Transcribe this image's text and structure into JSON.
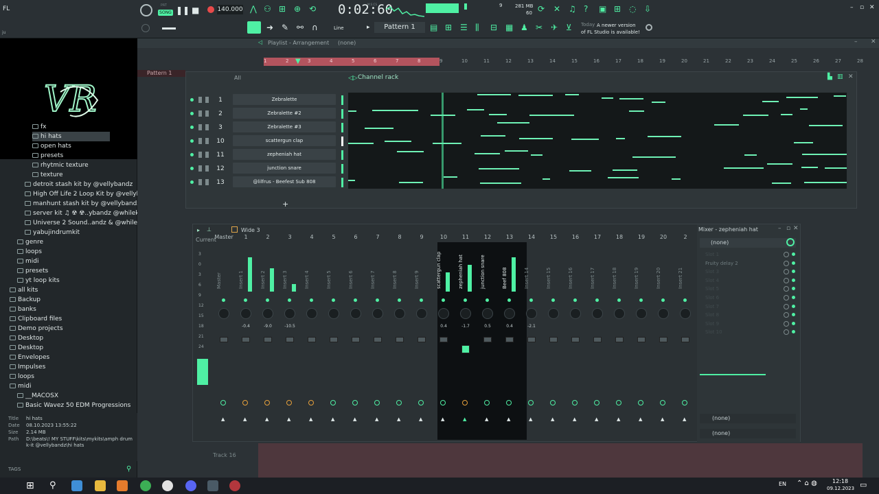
{
  "toolbar": {
    "menu": "FL",
    "song_mode": "SONG",
    "pat_label": "PAT",
    "tempo": "140.000",
    "time": "0:02:60",
    "time_unit": "M:S:CS",
    "memory": "281 MB",
    "cpu_line": "60",
    "poly": "9",
    "pattern": "Pattern 1",
    "snap": "Line",
    "news_today": "Today",
    "news_text": "A newer version of FL Studio is available!"
  },
  "browser": {
    "logo_text": "VR",
    "items": [
      {
        "label": "fx",
        "indent": 3
      },
      {
        "label": "hi hats",
        "indent": 3,
        "selected": true
      },
      {
        "label": "open hats",
        "indent": 3
      },
      {
        "label": "presets",
        "indent": 3
      },
      {
        "label": "rhytmic texture",
        "indent": 3
      },
      {
        "label": "texture",
        "indent": 3
      },
      {
        "label": "detroit stash kit by @vellybandz",
        "indent": 2
      },
      {
        "label": "High Off Life 2 Loop Kit by @vellybandz",
        "indent": 2
      },
      {
        "label": "manhunt stash kit by @vellybandz",
        "indent": 2
      },
      {
        "label": "server kit ♫ ☢ ☢..ybandz @whilekeed",
        "indent": 2
      },
      {
        "label": "Universe 2 Sound..andz & @whilekeed47",
        "indent": 2
      },
      {
        "label": "yabujindrumkit",
        "indent": 2
      },
      {
        "label": "genre",
        "indent": 1
      },
      {
        "label": "loops",
        "indent": 1
      },
      {
        "label": "midi",
        "indent": 1
      },
      {
        "label": "presets",
        "indent": 1
      },
      {
        "label": "yt loop kits",
        "indent": 1
      },
      {
        "label": "all kits",
        "indent": 0
      },
      {
        "label": "Backup",
        "indent": 0
      },
      {
        "label": "banks",
        "indent": 0
      },
      {
        "label": "Clipboard files",
        "indent": 0
      },
      {
        "label": "Demo projects",
        "indent": 0
      },
      {
        "label": "Desktop",
        "indent": 0
      },
      {
        "label": "Desktop",
        "indent": 0
      },
      {
        "label": "Envelopes",
        "indent": 0
      },
      {
        "label": "Impulses",
        "indent": 0
      },
      {
        "label": "loops",
        "indent": 0
      },
      {
        "label": "midi",
        "indent": 0
      },
      {
        "label": "__MACOSX",
        "indent": 1
      },
      {
        "label": "Basic Wavez 50 EDM Progressions",
        "indent": 1
      }
    ],
    "info": {
      "title_label": "Title",
      "title": "hi hats",
      "date_label": "Date",
      "date": "08.10.2023 13:55:22",
      "size_label": "Size",
      "size": "2.14 MB",
      "path_label": "Path",
      "path": "D:\\beats\\! MY STUFF\\kits\\mykits\\amph drum k-it @vellybandz\\hi hats"
    },
    "tags": "TAGS"
  },
  "playlist": {
    "title": "Playlist - Arrangement",
    "pattern_sel": "(none)",
    "pattern_tab": "Pattern 1",
    "track16": "Track 16",
    "ruler": [
      "1",
      "2",
      "3",
      "4",
      "5",
      "6",
      "7",
      "8",
      "9",
      "10",
      "11",
      "12",
      "13",
      "14",
      "15",
      "16",
      "17",
      "18",
      "19",
      "20",
      "21",
      "22",
      "23",
      "24",
      "25",
      "26",
      "27",
      "28"
    ]
  },
  "channel_rack": {
    "title": "Channel rack",
    "filter": "All",
    "channels": [
      {
        "num": "1",
        "name": "Zebralette"
      },
      {
        "num": "2",
        "name": "Zebralette #2"
      },
      {
        "num": "3",
        "name": "Zebralette #3"
      },
      {
        "num": "10",
        "name": "scattergun clap"
      },
      {
        "num": "11",
        "name": "zepheniah hat"
      },
      {
        "num": "12",
        "name": "junction snare"
      },
      {
        "num": "13",
        "name": "@lilfrus - Beefest Sub 808"
      }
    ],
    "add": "+"
  },
  "mixer": {
    "title": "Wide 3",
    "current": "Current",
    "master": "Master",
    "scale": [
      "3",
      "0",
      "3",
      "6",
      "9",
      "12",
      "15",
      "18",
      "21",
      "24"
    ],
    "strips": [
      {
        "num": "",
        "name": "Master",
        "value": ""
      },
      {
        "num": "1",
        "name": "Insert 1",
        "value": "-0.4"
      },
      {
        "num": "2",
        "name": "Insert 2",
        "value": "-9.0"
      },
      {
        "num": "3",
        "name": "Insert 3",
        "value": "-10.5"
      },
      {
        "num": "4",
        "name": "Insert 4",
        "value": ""
      },
      {
        "num": "5",
        "name": "Insert 5",
        "value": ""
      },
      {
        "num": "6",
        "name": "Insert 6",
        "value": ""
      },
      {
        "num": "7",
        "name": "Insert 7",
        "value": ""
      },
      {
        "num": "8",
        "name": "Insert 8",
        "value": ""
      },
      {
        "num": "9",
        "name": "Insert 9",
        "value": ""
      },
      {
        "num": "10",
        "name": "scattergun clap",
        "value": "0.4"
      },
      {
        "num": "11",
        "name": "zepheniah hat",
        "value": "-1.7"
      },
      {
        "num": "12",
        "name": "junction snare",
        "value": "0.5"
      },
      {
        "num": "13",
        "name": "Beef 808",
        "value": "0.4"
      },
      {
        "num": "14",
        "name": "Insert 14",
        "value": "-2.1"
      },
      {
        "num": "15",
        "name": "Insert 15",
        "value": ""
      },
      {
        "num": "16",
        "name": "Insert 16",
        "value": ""
      },
      {
        "num": "17",
        "name": "Insert 17",
        "value": ""
      },
      {
        "num": "18",
        "name": "Insert 18",
        "value": ""
      },
      {
        "num": "19",
        "name": "Insert 19",
        "value": ""
      },
      {
        "num": "20",
        "name": "Insert 20",
        "value": ""
      },
      {
        "num": "2",
        "name": "Insert 21",
        "value": ""
      }
    ],
    "fx_panel": {
      "title": "Mixer - zepheniah hat",
      "input": "(none)",
      "slots": [
        "Slot 1",
        "Fruity delay 2",
        "Slot 3",
        "Slot 4",
        "Slot 5",
        "Slot 6",
        "Slot 7",
        "Slot 8",
        "Slot 9",
        "Slot 10"
      ],
      "out1": "(none)",
      "out2": "(none)"
    }
  },
  "taskbar": {
    "lang": "EN",
    "time": "12:18",
    "date": "09.12.2023"
  },
  "colors": {
    "accent": "#4ff0a4",
    "bg": "#1d2225",
    "panel": "#2f3639"
  }
}
